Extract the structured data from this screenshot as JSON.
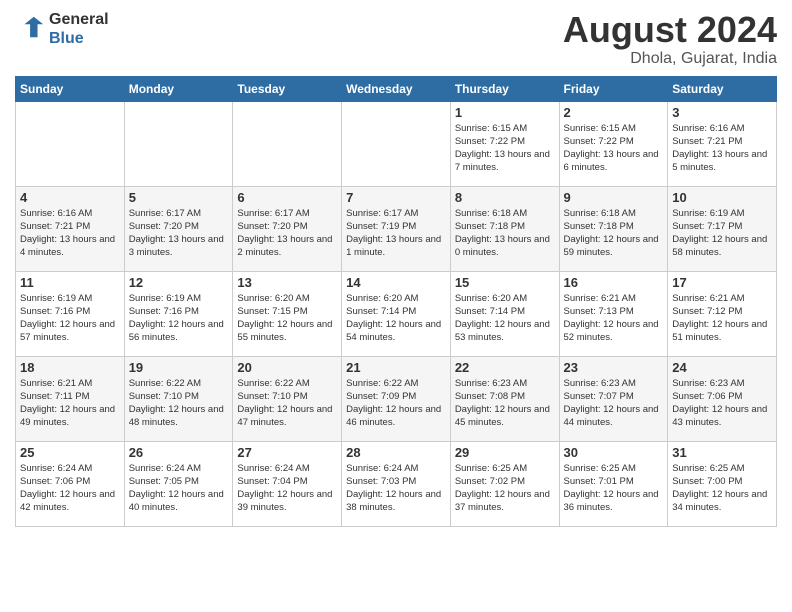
{
  "header": {
    "logo_line1": "General",
    "logo_line2": "Blue",
    "title": "August 2024",
    "subtitle": "Dhola, Gujarat, India"
  },
  "days_of_week": [
    "Sunday",
    "Monday",
    "Tuesday",
    "Wednesday",
    "Thursday",
    "Friday",
    "Saturday"
  ],
  "weeks": [
    [
      {
        "day": "",
        "info": ""
      },
      {
        "day": "",
        "info": ""
      },
      {
        "day": "",
        "info": ""
      },
      {
        "day": "",
        "info": ""
      },
      {
        "day": "1",
        "info": "Sunrise: 6:15 AM\nSunset: 7:22 PM\nDaylight: 13 hours\nand 7 minutes."
      },
      {
        "day": "2",
        "info": "Sunrise: 6:15 AM\nSunset: 7:22 PM\nDaylight: 13 hours\nand 6 minutes."
      },
      {
        "day": "3",
        "info": "Sunrise: 6:16 AM\nSunset: 7:21 PM\nDaylight: 13 hours\nand 5 minutes."
      }
    ],
    [
      {
        "day": "4",
        "info": "Sunrise: 6:16 AM\nSunset: 7:21 PM\nDaylight: 13 hours\nand 4 minutes."
      },
      {
        "day": "5",
        "info": "Sunrise: 6:17 AM\nSunset: 7:20 PM\nDaylight: 13 hours\nand 3 minutes."
      },
      {
        "day": "6",
        "info": "Sunrise: 6:17 AM\nSunset: 7:20 PM\nDaylight: 13 hours\nand 2 minutes."
      },
      {
        "day": "7",
        "info": "Sunrise: 6:17 AM\nSunset: 7:19 PM\nDaylight: 13 hours\nand 1 minute."
      },
      {
        "day": "8",
        "info": "Sunrise: 6:18 AM\nSunset: 7:18 PM\nDaylight: 13 hours\nand 0 minutes."
      },
      {
        "day": "9",
        "info": "Sunrise: 6:18 AM\nSunset: 7:18 PM\nDaylight: 12 hours\nand 59 minutes."
      },
      {
        "day": "10",
        "info": "Sunrise: 6:19 AM\nSunset: 7:17 PM\nDaylight: 12 hours\nand 58 minutes."
      }
    ],
    [
      {
        "day": "11",
        "info": "Sunrise: 6:19 AM\nSunset: 7:16 PM\nDaylight: 12 hours\nand 57 minutes."
      },
      {
        "day": "12",
        "info": "Sunrise: 6:19 AM\nSunset: 7:16 PM\nDaylight: 12 hours\nand 56 minutes."
      },
      {
        "day": "13",
        "info": "Sunrise: 6:20 AM\nSunset: 7:15 PM\nDaylight: 12 hours\nand 55 minutes."
      },
      {
        "day": "14",
        "info": "Sunrise: 6:20 AM\nSunset: 7:14 PM\nDaylight: 12 hours\nand 54 minutes."
      },
      {
        "day": "15",
        "info": "Sunrise: 6:20 AM\nSunset: 7:14 PM\nDaylight: 12 hours\nand 53 minutes."
      },
      {
        "day": "16",
        "info": "Sunrise: 6:21 AM\nSunset: 7:13 PM\nDaylight: 12 hours\nand 52 minutes."
      },
      {
        "day": "17",
        "info": "Sunrise: 6:21 AM\nSunset: 7:12 PM\nDaylight: 12 hours\nand 51 minutes."
      }
    ],
    [
      {
        "day": "18",
        "info": "Sunrise: 6:21 AM\nSunset: 7:11 PM\nDaylight: 12 hours\nand 49 minutes."
      },
      {
        "day": "19",
        "info": "Sunrise: 6:22 AM\nSunset: 7:10 PM\nDaylight: 12 hours\nand 48 minutes."
      },
      {
        "day": "20",
        "info": "Sunrise: 6:22 AM\nSunset: 7:10 PM\nDaylight: 12 hours\nand 47 minutes."
      },
      {
        "day": "21",
        "info": "Sunrise: 6:22 AM\nSunset: 7:09 PM\nDaylight: 12 hours\nand 46 minutes."
      },
      {
        "day": "22",
        "info": "Sunrise: 6:23 AM\nSunset: 7:08 PM\nDaylight: 12 hours\nand 45 minutes."
      },
      {
        "day": "23",
        "info": "Sunrise: 6:23 AM\nSunset: 7:07 PM\nDaylight: 12 hours\nand 44 minutes."
      },
      {
        "day": "24",
        "info": "Sunrise: 6:23 AM\nSunset: 7:06 PM\nDaylight: 12 hours\nand 43 minutes."
      }
    ],
    [
      {
        "day": "25",
        "info": "Sunrise: 6:24 AM\nSunset: 7:06 PM\nDaylight: 12 hours\nand 42 minutes."
      },
      {
        "day": "26",
        "info": "Sunrise: 6:24 AM\nSunset: 7:05 PM\nDaylight: 12 hours\nand 40 minutes."
      },
      {
        "day": "27",
        "info": "Sunrise: 6:24 AM\nSunset: 7:04 PM\nDaylight: 12 hours\nand 39 minutes."
      },
      {
        "day": "28",
        "info": "Sunrise: 6:24 AM\nSunset: 7:03 PM\nDaylight: 12 hours\nand 38 minutes."
      },
      {
        "day": "29",
        "info": "Sunrise: 6:25 AM\nSunset: 7:02 PM\nDaylight: 12 hours\nand 37 minutes."
      },
      {
        "day": "30",
        "info": "Sunrise: 6:25 AM\nSunset: 7:01 PM\nDaylight: 12 hours\nand 36 minutes."
      },
      {
        "day": "31",
        "info": "Sunrise: 6:25 AM\nSunset: 7:00 PM\nDaylight: 12 hours\nand 34 minutes."
      }
    ]
  ]
}
